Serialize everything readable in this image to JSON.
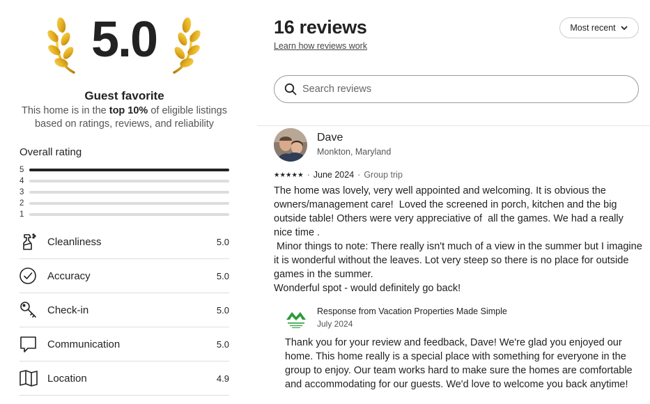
{
  "badge": {
    "score": "5.0",
    "title": "Guest favorite",
    "text_pre": "This home is in the ",
    "text_bold": "top 10%",
    "text_post": " of eligible listings based on ratings, reviews, and reliability"
  },
  "overall": {
    "label": "Overall rating",
    "distribution": [
      {
        "star": "5",
        "fraction": 1.0
      },
      {
        "star": "4",
        "fraction": 0.0
      },
      {
        "star": "3",
        "fraction": 0.0
      },
      {
        "star": "2",
        "fraction": 0.0
      },
      {
        "star": "1",
        "fraction": 0.0
      }
    ]
  },
  "categories": [
    {
      "label": "Cleanliness",
      "score": "5.0",
      "icon": "spray-bottle-icon"
    },
    {
      "label": "Accuracy",
      "score": "5.0",
      "icon": "check-circle-icon"
    },
    {
      "label": "Check-in",
      "score": "5.0",
      "icon": "key-icon"
    },
    {
      "label": "Communication",
      "score": "5.0",
      "icon": "chat-bubble-icon"
    },
    {
      "label": "Location",
      "score": "4.9",
      "icon": "map-icon"
    }
  ],
  "reviews_header": {
    "title": "16 reviews",
    "learn_link": "Learn how reviews work",
    "sort_label": "Most recent"
  },
  "search": {
    "placeholder": "Search reviews"
  },
  "review": {
    "name": "Dave",
    "location": "Monkton, Maryland",
    "stars": "★★★★★",
    "date": "June 2024",
    "trip_type": "Group trip",
    "body": [
      "The home was lovely, very well appointed and welcoming. It is obvious the owners/management care!  Loved the screened in porch, kitchen and the big outside table! Others were very appreciative of  all the games. We had a really nice time .",
      " Minor things to note: There really isn't much of a view in the summer but I imagine it is wonderful without the leaves. Lot very steep so there is no place for outside games in the summer.",
      "Wonderful spot - would definitely go back!"
    ],
    "response": {
      "title": "Response from Vacation Properties Made Simple",
      "date": "July 2024",
      "body": "Thank you for your review and feedback, Dave! We're glad you enjoyed our home. This home really is a special place with something for everyone in the group to enjoy. Our team works hard to make sure the homes are comfortable and accommodating for our guests. We'd love to welcome you back anytime!"
    }
  },
  "colors": {
    "text": "#222222",
    "muted": "#555555",
    "divider": "#dddddd",
    "laurel_gold": "#e3ad1f",
    "host_logo_green": "#2e9b3a"
  }
}
